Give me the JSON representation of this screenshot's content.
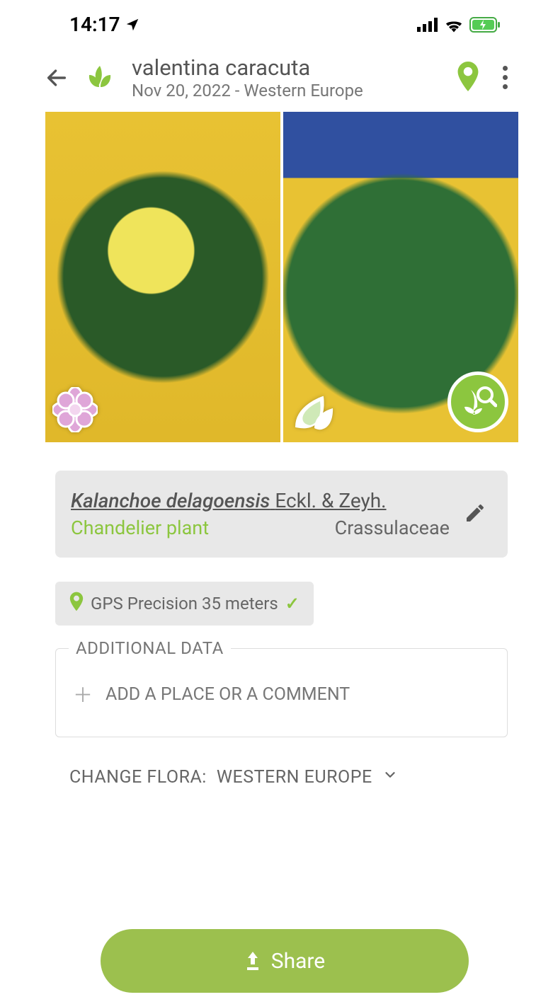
{
  "status": {
    "time": "14:17"
  },
  "header": {
    "title": "valentina caracuta",
    "subtitle": "Nov 20, 2022 - Western Europe"
  },
  "species": {
    "scientific_name": "Kalanchoe delagoensis",
    "authority": "Eckl. & Zeyh.",
    "common_name": "Chandelier plant",
    "family": "Crassulaceae"
  },
  "gps": {
    "label": "GPS Precision 35 meters"
  },
  "additional": {
    "legend": "ADDITIONAL DATA",
    "add_label": "ADD A PLACE OR A COMMENT"
  },
  "flora": {
    "prefix": "CHANGE FLORA:",
    "value": "WESTERN EUROPE"
  },
  "share": {
    "label": "Share"
  }
}
